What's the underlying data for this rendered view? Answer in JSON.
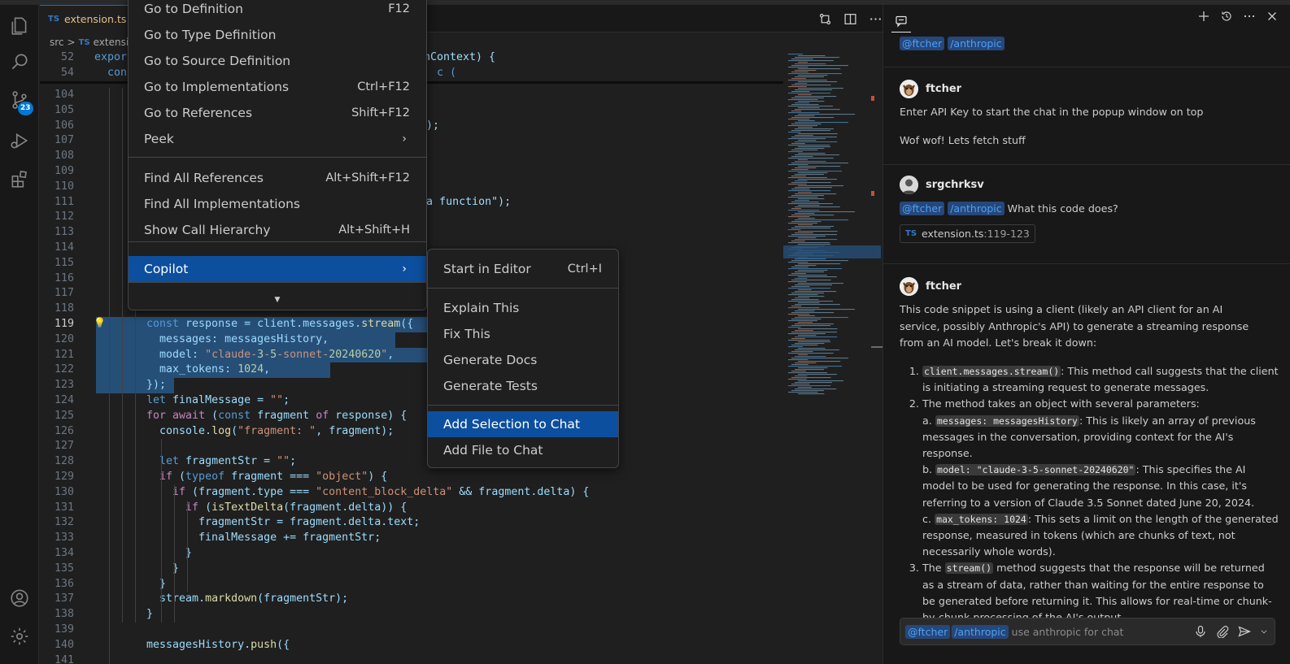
{
  "activity_bar": {
    "source_control_badge": "23"
  },
  "editor": {
    "tab": {
      "icon": "TS",
      "name": "extension.ts",
      "modified_marker": "M"
    },
    "breadcrumb": {
      "folder": "src",
      "separator": ">",
      "file_icon": "TS",
      "file": "extension"
    },
    "sticky": [
      {
        "num": "52",
        "text": "expor"
      },
      {
        "num": "54",
        "text": "  con"
      }
    ],
    "sticky_partial_right": {
      "line52": "nContext) {",
      "line54": "c ("
    },
    "lines": [
      {
        "num": "104",
        "text": ""
      },
      {
        "num": "105",
        "text": ""
      },
      {
        "num": "106",
        "text": "t:\", code);"
      },
      {
        "num": "107",
        "text": ""
      },
      {
        "num": "108",
        "text": ""
      },
      {
        "num": "109",
        "text": ""
      },
      {
        "num": "110",
        "text": ""
      },
      {
        "num": "111",
        "text": "s is not a function\");"
      },
      {
        "num": "112",
        "text": ""
      },
      {
        "num": "113",
        "text": ""
      },
      {
        "num": "114",
        "text": ""
      },
      {
        "num": "115",
        "text": ""
      },
      {
        "num": "116",
        "text": ""
      },
      {
        "num": "117",
        "text": ""
      },
      {
        "num": "118",
        "text": ""
      },
      {
        "num": "119",
        "text": "const response = client.messages.stream({"
      },
      {
        "num": "120",
        "text": "  messages: messagesHistory,"
      },
      {
        "num": "121",
        "text": "  model: \"claude-3-5-sonnet-20240620\","
      },
      {
        "num": "122",
        "text": "  max_tokens: 1024,"
      },
      {
        "num": "123",
        "text": "});"
      },
      {
        "num": "124",
        "text": "let finalMessage = \"\";"
      },
      {
        "num": "125",
        "text": "for await (const fragment of response) {"
      },
      {
        "num": "126",
        "text": "  console.log(\"fragment: \", fragment);"
      },
      {
        "num": "127",
        "text": ""
      },
      {
        "num": "128",
        "text": "  let fragmentStr = \"\";"
      },
      {
        "num": "129",
        "text": "  if (typeof fragment === \"object\") {"
      },
      {
        "num": "130",
        "text": "    if (fragment.type === \"content_block_delta\" && fragment.delta) {"
      },
      {
        "num": "131",
        "text": "      if (isTextDelta(fragment.delta)) {"
      },
      {
        "num": "132",
        "text": "        fragmentStr = fragment.delta.text;"
      },
      {
        "num": "133",
        "text": "        finalMessage += fragmentStr;"
      },
      {
        "num": "134",
        "text": "      }"
      },
      {
        "num": "135",
        "text": "    }"
      },
      {
        "num": "136",
        "text": "  }"
      },
      {
        "num": "137",
        "text": "  stream.markdown(fragmentStr);"
      },
      {
        "num": "138",
        "text": "}"
      },
      {
        "num": "139",
        "text": ""
      },
      {
        "num": "140",
        "text": "messagesHistory.push({"
      },
      {
        "num": "141",
        "text": ""
      }
    ]
  },
  "context_menu": {
    "items": [
      {
        "label": "Go to Definition",
        "key": "F12"
      },
      {
        "label": "Go to Type Definition",
        "key": ""
      },
      {
        "label": "Go to Source Definition",
        "key": ""
      },
      {
        "label": "Go to Implementations",
        "key": "Ctrl+F12"
      },
      {
        "label": "Go to References",
        "key": "Shift+F12"
      },
      {
        "label": "Peek",
        "key": ""
      },
      {
        "label": "Find All References",
        "key": "Alt+Shift+F12"
      },
      {
        "label": "Find All Implementations",
        "key": ""
      },
      {
        "label": "Show Call Hierarchy",
        "key": "Alt+Shift+H"
      },
      {
        "label": "Copilot",
        "key": ""
      }
    ]
  },
  "copilot_submenu": {
    "items": [
      {
        "label": "Start in Editor",
        "key": "Ctrl+I"
      },
      {
        "label": "Explain This"
      },
      {
        "label": "Fix This"
      },
      {
        "label": "Generate Docs"
      },
      {
        "label": "Generate Tests"
      },
      {
        "label": "Add Selection to Chat"
      },
      {
        "label": "Add File to Chat"
      }
    ]
  },
  "chat": {
    "top_chips": [
      "@ftcher",
      "/anthropic"
    ],
    "messages": [
      {
        "author": "ftcher",
        "lines": [
          "Enter API Key to start the chat in the popup window on top",
          "Wof wof! Lets fetch stuff"
        ]
      },
      {
        "author": "srgchrksv",
        "chips": [
          "@ftcher",
          "/anthropic"
        ],
        "text": "What this code does?",
        "ref_icon": "TS",
        "ref_file": "extension.ts",
        "ref_range": ":119-123"
      },
      {
        "author": "ftcher",
        "intro": "This code snippet is using a client (likely an API client for an AI service, possibly Anthropic's API) to generate a streaming response from an AI model. Let's break it down:",
        "items": [
          {
            "code": "client.messages.stream()",
            "text": ": This method call suggests that the client is initiating a streaming request to generate messages."
          },
          {
            "text": "The method takes an object with several parameters:"
          },
          {
            "prefix": "a.",
            "code": "messages: messagesHistory",
            "text": ": This is likely an array of previous messages in the conversation, providing context for the AI's response."
          },
          {
            "prefix": "b.",
            "code": "model: \"claude-3-5-sonnet-20240620\"",
            "text": ": This specifies the AI model to be used for generating the response. In this case, it's referring to a version of Claude 3.5 Sonnet dated June 20, 2024."
          },
          {
            "prefix": "c.",
            "code": "max_tokens: 1024",
            "text": ": This sets a limit on the length of the generated response, measured in tokens (which are chunks of text, not necessarily whole words)."
          },
          {
            "prefix": "The",
            "code": "stream()",
            "text": " method suggests that the response will be returned as a stream of data, rather than waiting for the entire response to be generated before returning it. This allows for real-time or chunk-by-chunk processing of the AI's output."
          }
        ]
      }
    ],
    "input": {
      "chips": [
        "@ftcher",
        "/anthropic"
      ],
      "placeholder": "use anthropic for chat"
    }
  },
  "colors": {
    "accent": "#0078d4",
    "menu_highlight": "#0c4f9e",
    "selection": "#264f78"
  }
}
